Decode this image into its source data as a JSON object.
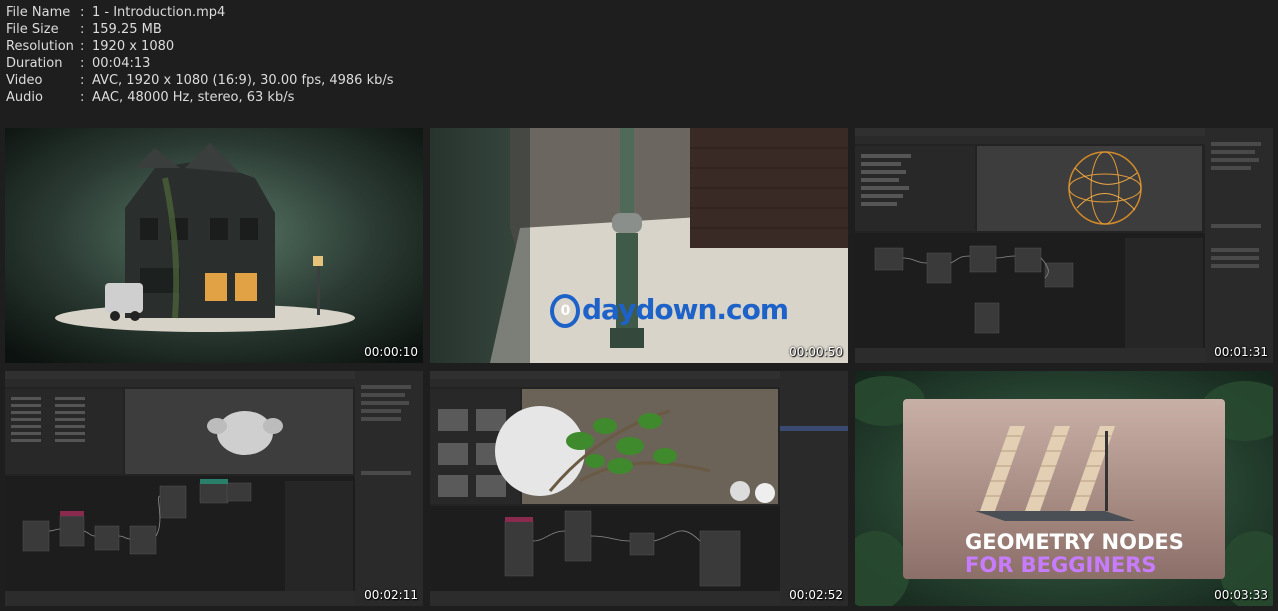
{
  "info": [
    {
      "key": "File Name",
      "value": "1 - Introduction.mp4"
    },
    {
      "key": "File Size",
      "value": "159.25 MB"
    },
    {
      "key": "Resolution",
      "value": "1920 x 1080"
    },
    {
      "key": "Duration",
      "value": "00:04:13"
    },
    {
      "key": "Video",
      "value": "AVC, 1920 x 1080 (16:9), 30.00 fps, 4986 kb/s"
    },
    {
      "key": "Audio",
      "value": "AAC, 48000 Hz, stereo, 63 kb/s"
    }
  ],
  "separator": ":",
  "thumbs": [
    {
      "time": "00:00:10"
    },
    {
      "time": "00:00:50"
    },
    {
      "time": "00:01:31"
    },
    {
      "time": "00:02:11"
    },
    {
      "time": "00:02:52"
    },
    {
      "time": "00:03:33"
    }
  ],
  "watermark": {
    "text": "daydown.com",
    "o": "0"
  },
  "promo": {
    "line1": "GEOMETRY NODES",
    "line2": "FOR BEGGINERS"
  }
}
